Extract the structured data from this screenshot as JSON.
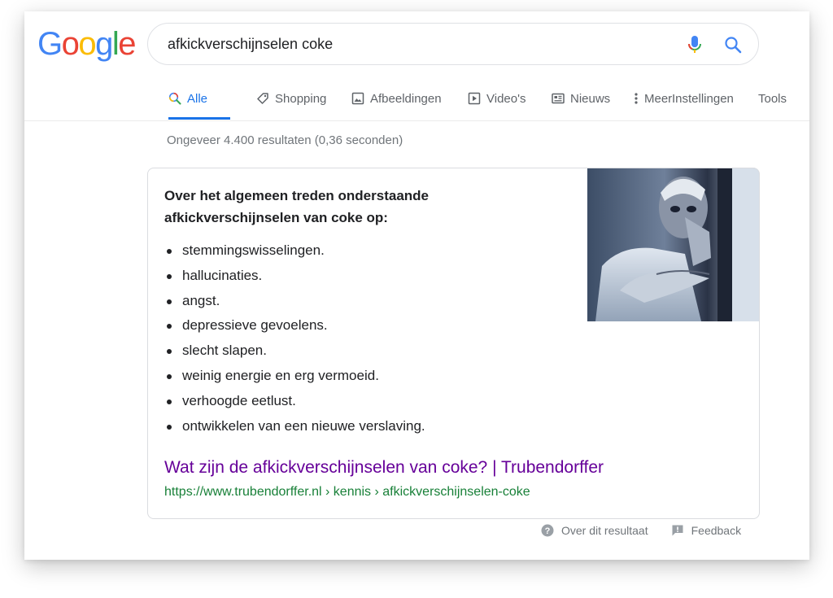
{
  "header": {
    "logo_letters": [
      {
        "char": "G",
        "color": "#4285F4"
      },
      {
        "char": "o",
        "color": "#EA4335"
      },
      {
        "char": "o",
        "color": "#FBBC05"
      },
      {
        "char": "g",
        "color": "#4285F4"
      },
      {
        "char": "l",
        "color": "#34A853"
      },
      {
        "char": "e",
        "color": "#EA4335"
      }
    ],
    "search_query": "afkickverschijnselen coke",
    "mic_icon": "microphone-icon",
    "search_icon": "search-icon"
  },
  "tabs": [
    {
      "label": "Alle",
      "icon": "search-icon",
      "active": true
    },
    {
      "label": "Shopping",
      "icon": "tag-icon"
    },
    {
      "label": "Afbeeldingen",
      "icon": "image-icon"
    },
    {
      "label": "Video's",
      "icon": "play-icon"
    },
    {
      "label": "Nieuws",
      "icon": "news-icon"
    },
    {
      "label": "Meer",
      "icon": "more-vertical-icon"
    },
    {
      "label": "Instellingen"
    },
    {
      "label": "Tools"
    }
  ],
  "stats": "Ongeveer 4.400 resultaten (0,36 seconden)",
  "snippet": {
    "heading": "Over het algemeen treden onderstaande afkickverschijnselen van coke op:",
    "items": [
      "stemmingswisselingen.",
      "hallucinaties.",
      "angst.",
      "depressieve gevoelens.",
      "slecht slapen.",
      "weinig energie en erg vermoeid.",
      "verhoogde eetlust.",
      "ontwikkelen van een nieuwe verslaving."
    ],
    "title": "Wat zijn de afkickverschijnselen van coke? | Trubendorffer",
    "url": "https://www.trubendorffer.nl › kennis › afkickverschijnselen-coke"
  },
  "footer": {
    "about_label": "Over dit resultaat",
    "feedback_label": "Feedback"
  },
  "colors": {
    "accent": "#1a73e8",
    "visited_link": "#660099",
    "url_green": "#188038",
    "secondary_text": "#70757a"
  }
}
